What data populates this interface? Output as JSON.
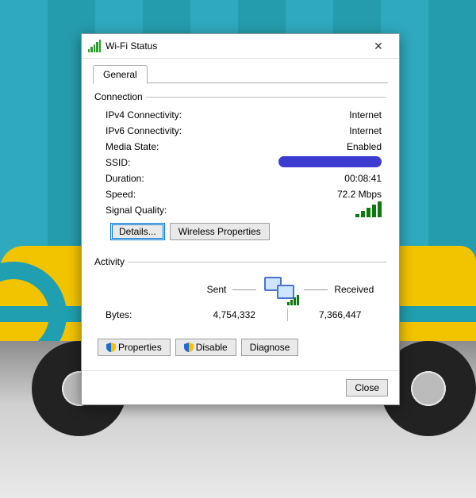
{
  "title": "Wi-Fi Status",
  "tabs": {
    "general": "General"
  },
  "groups": {
    "connection": "Connection",
    "activity": "Activity"
  },
  "connection": {
    "ipv4_label": "IPv4 Connectivity:",
    "ipv4_value": "Internet",
    "ipv6_label": "IPv6 Connectivity:",
    "ipv6_value": "Internet",
    "media_label": "Media State:",
    "media_value": "Enabled",
    "ssid_label": "SSID:",
    "ssid_value_redacted": true,
    "duration_label": "Duration:",
    "duration_value": "00:08:41",
    "speed_label": "Speed:",
    "speed_value": "72.2 Mbps",
    "signal_label": "Signal Quality:",
    "signal_bars": 5
  },
  "buttons": {
    "details": "Details...",
    "wireless_props": "Wireless Properties",
    "properties": "Properties",
    "disable": "Disable",
    "diagnose": "Diagnose",
    "close": "Close"
  },
  "activity": {
    "sent_label": "Sent",
    "received_label": "Received",
    "bytes_label": "Bytes:",
    "bytes_sent": "4,754,332",
    "bytes_received": "7,366,447"
  }
}
